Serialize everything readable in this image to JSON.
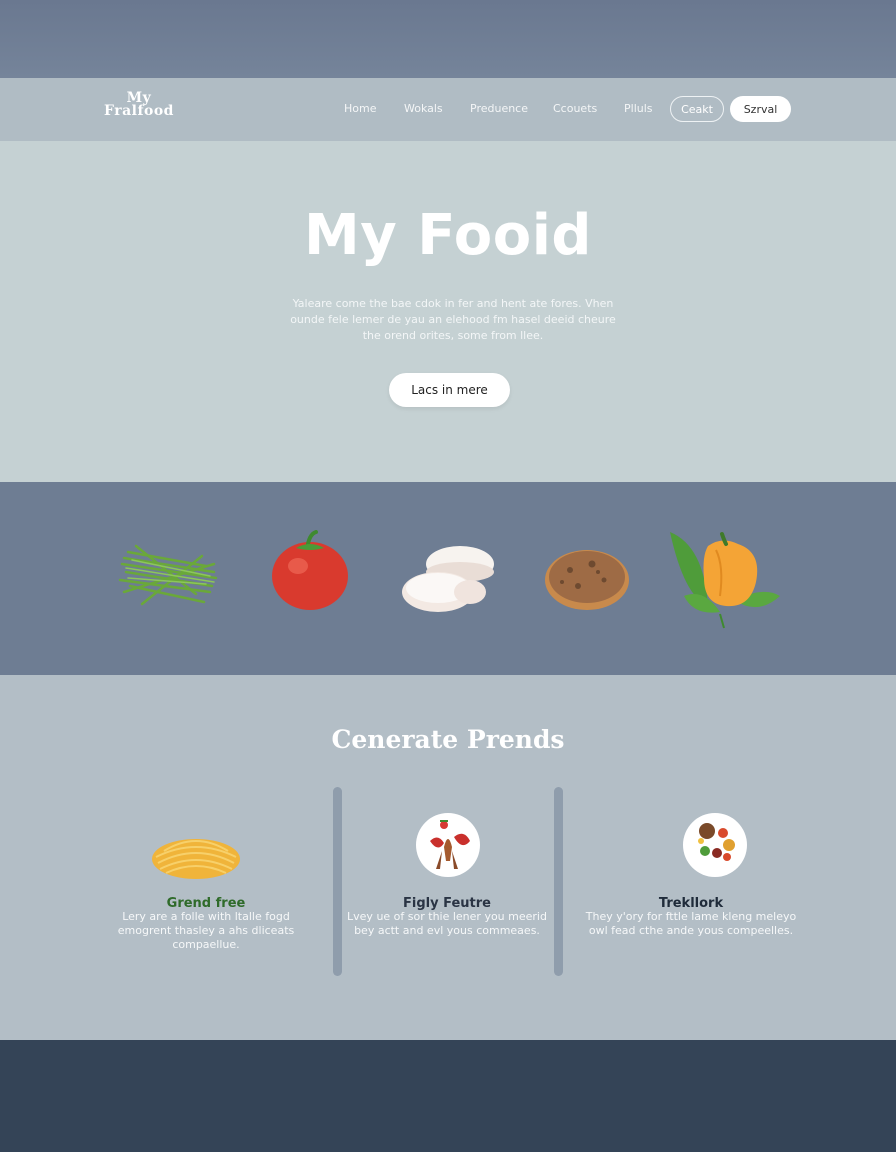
{
  "brand": {
    "logo_line1": "My",
    "logo_line2": "Fralfood"
  },
  "nav": {
    "links": [
      "Home",
      "Wokals",
      "Preduence",
      "Ccouets",
      "Plluls"
    ],
    "outline_button": "Ceakt",
    "solid_button": "Szrval"
  },
  "hero": {
    "title": "My Fooid",
    "text": "Yaleare come the bae cdok in fer and hent ate fores. Vhen ounde fele lemer de yau an elehood fm hasel deeid cheure the orend orites, some from llee.",
    "button": "Lacs in mere"
  },
  "ingredients": [
    "chives-icon",
    "tomato-icon",
    "mozzarella-icon",
    "bread-icon",
    "bell-pepper-icon"
  ],
  "features": {
    "title": "Cenerate Prends",
    "cards": [
      {
        "title": "Grend free",
        "title_color": "#2f6b2a",
        "text": "Lery are a folle with ltalle fogd emogrent thasley a ahs dliceats compaellue.",
        "icon": "pasta-icon"
      },
      {
        "title": "Figly Feutre",
        "title_color": "#2a3444",
        "text": "Lvey ue of sor thie lener you meerid bey actt and evl yous commeaes.",
        "icon": "strawberry-bowl-icon"
      },
      {
        "title": "Trekllork",
        "title_color": "#1f2b3a",
        "text": "They y'ory for fttle lame kleng meleyo owl fead cthe ande yous compeelles.",
        "icon": "vegetable-bowl-icon"
      }
    ]
  },
  "colors": {
    "top_band": "#6a7890",
    "navbar": "#b0bcc4",
    "hero": "#c5d1d3",
    "ingredients_band": "#6e7d93",
    "features": "#b3bec6",
    "footer": "#344457"
  }
}
